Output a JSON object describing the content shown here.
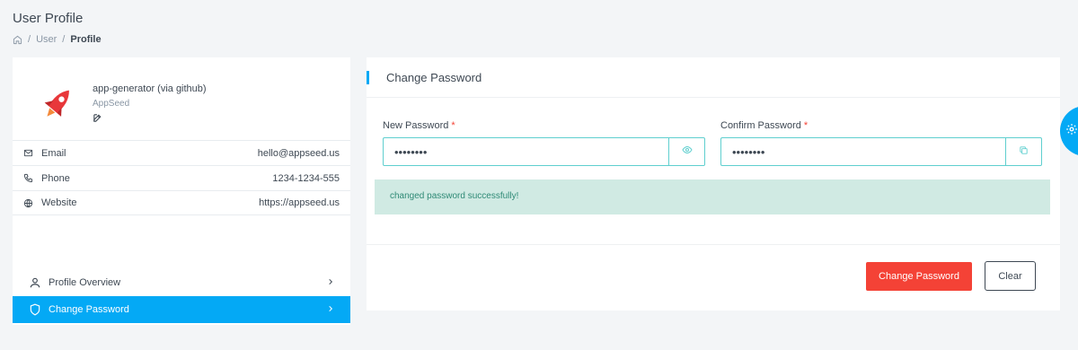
{
  "page": {
    "title": "User Profile",
    "breadcrumb": [
      "User",
      "Profile"
    ]
  },
  "profile": {
    "name": "app-generator (via github)",
    "org": "AppSeed",
    "info": [
      {
        "label": "Email",
        "value": "hello@appseed.us",
        "icon": "mail-icon"
      },
      {
        "label": "Phone",
        "value": "1234-1234-555",
        "icon": "phone-icon"
      },
      {
        "label": "Website",
        "value": "https://appseed.us",
        "icon": "globe-icon"
      }
    ]
  },
  "nav": {
    "items": [
      {
        "label": "Profile Overview",
        "icon": "user-icon",
        "active": false
      },
      {
        "label": "Change Password",
        "icon": "shield-icon",
        "active": true
      }
    ]
  },
  "change_password": {
    "title": "Change Password",
    "new_label": "New Password",
    "confirm_label": "Confirm Password",
    "required_mark": "*",
    "new_value": "••••••••",
    "confirm_value": "••••••••",
    "alert": "changed password successfully!",
    "submit_label": "Change Password",
    "clear_label": "Clear"
  },
  "colors": {
    "accent": "#04a9f5",
    "danger": "#f44236",
    "success_bg": "#d0eae3",
    "success_text": "#2f8a76",
    "input_border": "#5fcfcf"
  }
}
